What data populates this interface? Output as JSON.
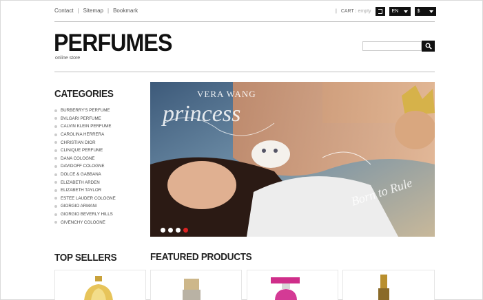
{
  "topnav": {
    "links": [
      "Contact",
      "Sitemap",
      "Bookmark"
    ]
  },
  "cart": {
    "label": "CART :",
    "status": "empty"
  },
  "language": {
    "selected": "EN"
  },
  "currency": {
    "selected": "$"
  },
  "logo": {
    "title": "PERFUMES",
    "tagline": "online store"
  },
  "search": {
    "placeholder": ""
  },
  "categories": {
    "title": "CATEGORIES",
    "items": [
      "BURBERRY'S PERFUME",
      "BVLGARI PERFUME",
      "CALVIN KLEIN PERFUME",
      "CAROLINA HERRERA",
      "CHRISTIAN DIOR",
      "CLINIQUE PERFUME",
      "DANA COLOGNE",
      "DAVIDOFF COLOGNE",
      "DOLCE & GABBANA",
      "ELIZABETH ARDEN",
      "ELIZABETH TAYLOR",
      "ESTEE LAUDER COLOGNE",
      "GIORGIO ARMANI",
      "GIORGIO BEVERLY HILLS",
      "GIVENCHY COLOGNE"
    ]
  },
  "banner": {
    "brand": "VERA WANG",
    "script": "princess",
    "script2": "Born to Rule",
    "slides": 4,
    "active_slide": 4
  },
  "sections": {
    "top_sellers": "TOP SELLERS",
    "featured": "FEATURED PRODUCTS"
  },
  "colors": {
    "accent": "#111111",
    "active_dot": "#dd2222"
  }
}
